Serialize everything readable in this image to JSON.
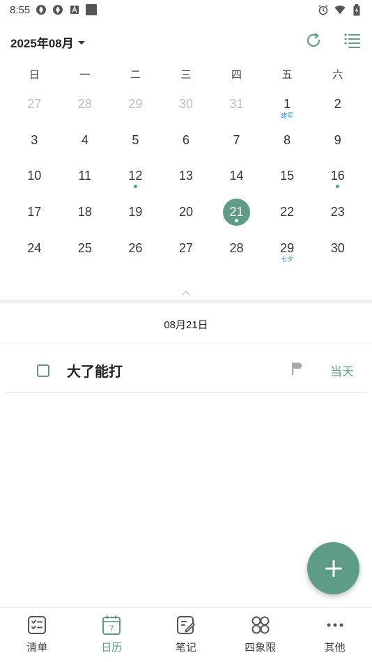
{
  "status_bar": {
    "time": "8:55"
  },
  "header": {
    "month_title": "2025年08月"
  },
  "weekdays": [
    "日",
    "一",
    "二",
    "三",
    "四",
    "五",
    "六"
  ],
  "calendar": {
    "days": [
      {
        "n": "27",
        "muted": true
      },
      {
        "n": "28",
        "muted": true
      },
      {
        "n": "29",
        "muted": true
      },
      {
        "n": "30",
        "muted": true
      },
      {
        "n": "31",
        "muted": true
      },
      {
        "n": "1",
        "sub": "建军"
      },
      {
        "n": "2"
      },
      {
        "n": "3"
      },
      {
        "n": "4"
      },
      {
        "n": "5"
      },
      {
        "n": "6"
      },
      {
        "n": "7"
      },
      {
        "n": "8"
      },
      {
        "n": "9"
      },
      {
        "n": "10"
      },
      {
        "n": "11"
      },
      {
        "n": "12",
        "dot": true
      },
      {
        "n": "13"
      },
      {
        "n": "14"
      },
      {
        "n": "15"
      },
      {
        "n": "16",
        "dot": true
      },
      {
        "n": "17"
      },
      {
        "n": "18"
      },
      {
        "n": "19"
      },
      {
        "n": "20"
      },
      {
        "n": "21",
        "selected": true,
        "dot": true
      },
      {
        "n": "22"
      },
      {
        "n": "23"
      },
      {
        "n": "24"
      },
      {
        "n": "25"
      },
      {
        "n": "26"
      },
      {
        "n": "27"
      },
      {
        "n": "28"
      },
      {
        "n": "29",
        "sub": "七夕"
      },
      {
        "n": "30"
      }
    ]
  },
  "selected_date": "08月21日",
  "task": {
    "title": "大了能打",
    "when": "当天"
  },
  "bottom_nav": [
    {
      "label": "清单",
      "icon": "checklist-icon"
    },
    {
      "label": "日历",
      "icon": "calendar-icon",
      "active": true
    },
    {
      "label": "笔记",
      "icon": "note-icon"
    },
    {
      "label": "四象限",
      "icon": "quadrant-icon"
    },
    {
      "label": "其他",
      "icon": "more-icon"
    }
  ],
  "colors": {
    "accent": "#5f9c86",
    "festival": "#2a8fd6",
    "muted": "#bdbdbd"
  }
}
